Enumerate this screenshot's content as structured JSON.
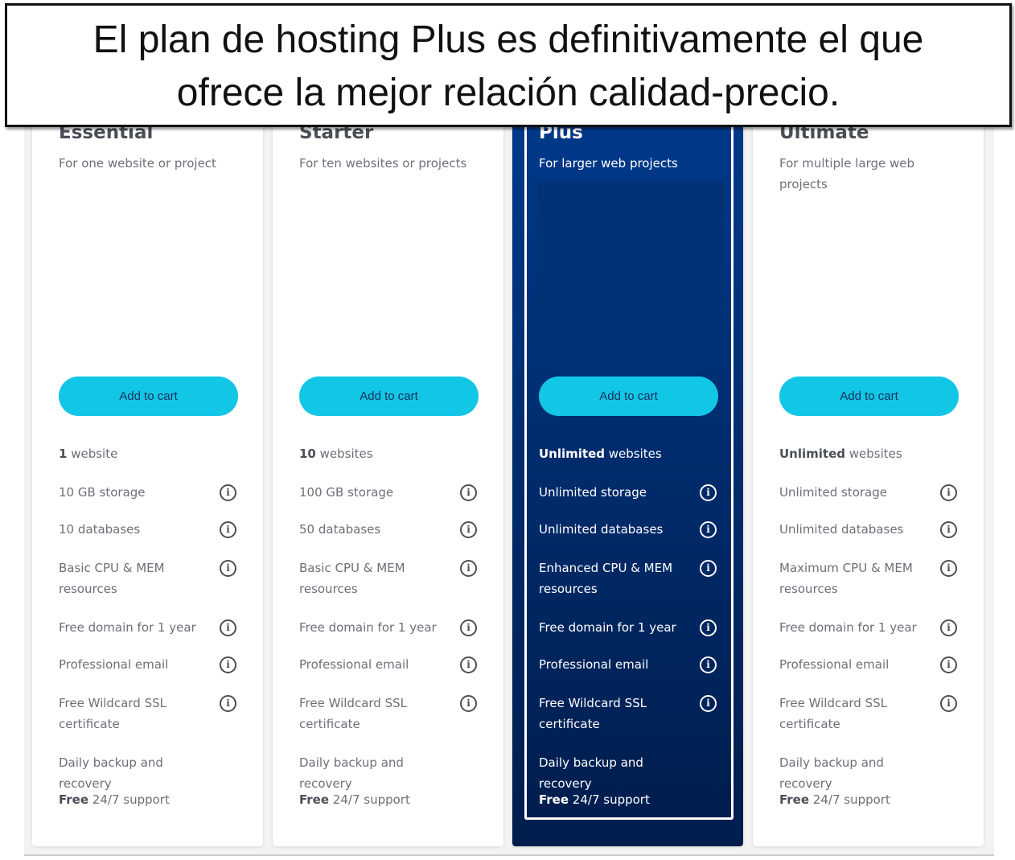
{
  "banner": {
    "line1": "El plan de hosting Plus es definitivamente el que",
    "line2": "ofrece la mejor relación calidad-precio."
  },
  "plans": [
    {
      "name": "Essential",
      "subtitle": "For one website or project",
      "button": "Add to cart",
      "features": [
        {
          "bold": "1",
          "text": " website"
        },
        {
          "bold": "",
          "text": "10 GB storage"
        },
        {
          "bold": "",
          "text": "10 databases"
        },
        {
          "bold": "",
          "text": "Basic CPU & MEM resources"
        },
        {
          "bold": "",
          "text": "Free domain for 1 year"
        },
        {
          "bold": "",
          "text": "Professional email"
        },
        {
          "bold": "",
          "text": "Free Wildcard SSL certificate"
        },
        {
          "bold": "",
          "text": "Daily backup and recovery"
        },
        {
          "bold": "Free",
          "text": " 24/7 support"
        }
      ]
    },
    {
      "name": "Starter",
      "subtitle": "For ten websites or projects",
      "button": "Add to cart",
      "features": [
        {
          "bold": "10",
          "text": " websites"
        },
        {
          "bold": "",
          "text": "100 GB storage"
        },
        {
          "bold": "",
          "text": "50 databases"
        },
        {
          "bold": "",
          "text": "Basic CPU & MEM resources"
        },
        {
          "bold": "",
          "text": "Free domain for 1 year"
        },
        {
          "bold": "",
          "text": "Professional email"
        },
        {
          "bold": "",
          "text": "Free Wildcard SSL certificate"
        },
        {
          "bold": "",
          "text": "Daily backup and recovery"
        },
        {
          "bold": "Free",
          "text": " 24/7 support"
        }
      ]
    },
    {
      "name": "Plus",
      "subtitle": "For larger web projects",
      "button": "Add to cart",
      "features": [
        {
          "bold": "Unlimited",
          "text": " websites"
        },
        {
          "bold": "",
          "text": "Unlimited storage"
        },
        {
          "bold": "",
          "text": "Unlimited databases"
        },
        {
          "bold": "",
          "text": "Enhanced CPU & MEM resources"
        },
        {
          "bold": "",
          "text": "Free domain for 1 year"
        },
        {
          "bold": "",
          "text": "Professional email"
        },
        {
          "bold": "",
          "text": "Free Wildcard SSL certificate"
        },
        {
          "bold": "",
          "text": "Daily backup and recovery"
        },
        {
          "bold": "Free",
          "text": " 24/7 support"
        }
      ]
    },
    {
      "name": "Ultimate",
      "subtitle": "For multiple large web projects",
      "button": "Add to cart",
      "features": [
        {
          "bold": "Unlimited",
          "text": " websites"
        },
        {
          "bold": "",
          "text": "Unlimited storage"
        },
        {
          "bold": "",
          "text": "Unlimited databases"
        },
        {
          "bold": "",
          "text": "Maximum CPU & MEM resources"
        },
        {
          "bold": "",
          "text": "Free domain for 1 year"
        },
        {
          "bold": "",
          "text": "Professional email"
        },
        {
          "bold": "",
          "text": "Free Wildcard SSL certificate"
        },
        {
          "bold": "",
          "text": "Daily backup and recovery"
        },
        {
          "bold": "Free",
          "text": " 24/7 support"
        }
      ]
    }
  ],
  "info_icon": "info-circle-icon",
  "colors": {
    "button": "#12c6e6",
    "highlight": "#003a8c"
  }
}
